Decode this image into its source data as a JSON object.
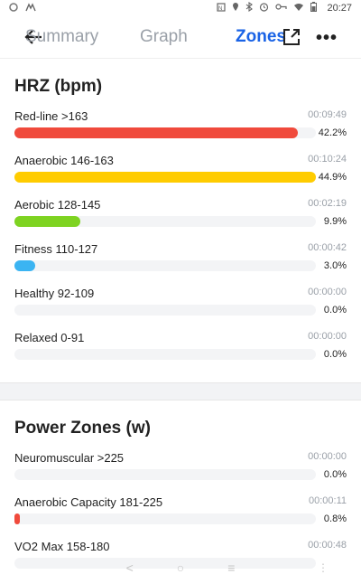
{
  "status": {
    "time": "20:27",
    "icons": [
      "notification-app-icon",
      "app-icon",
      "nfc-icon",
      "location-icon",
      "bluetooth-icon",
      "alarm-icon",
      "vpn-key-icon",
      "wifi-icon",
      "battery-icon"
    ]
  },
  "header": {
    "tabs": [
      {
        "label": "Summary",
        "active": false
      },
      {
        "label": "Graph",
        "active": false
      },
      {
        "label": "Zones",
        "active": true
      }
    ],
    "accent": "#1a63e6"
  },
  "hrz": {
    "title": "HRZ (bpm)",
    "zones": [
      {
        "name": "Red-line  >163",
        "time": "00:09:49",
        "pct_label": "42.2%",
        "fraction": 0.94,
        "color": "#f04a3c"
      },
      {
        "name": "Anaerobic  146-163",
        "time": "00:10:24",
        "pct_label": "44.9%",
        "fraction": 1.0,
        "color": "#ffcc00"
      },
      {
        "name": "Aerobic  128-145",
        "time": "00:02:19",
        "pct_label": "9.9%",
        "fraction": 0.22,
        "color": "#7ed321"
      },
      {
        "name": "Fitness  110-127",
        "time": "00:00:42",
        "pct_label": "3.0%",
        "fraction": 0.068,
        "color": "#3bb4f2"
      },
      {
        "name": "Healthy  92-109",
        "time": "00:00:00",
        "pct_label": "0.0%",
        "fraction": 0.0,
        "color": "#3bb4f2"
      },
      {
        "name": "Relaxed  0-91",
        "time": "00:00:00",
        "pct_label": "0.0%",
        "fraction": 0.0,
        "color": "#3bb4f2"
      }
    ]
  },
  "power": {
    "title": "Power Zones (w)",
    "zones": [
      {
        "name": "Neuromuscular  >225",
        "time": "00:00:00",
        "pct_label": "0.0%",
        "fraction": 0.0,
        "color": "#f04a3c"
      },
      {
        "name": "Anaerobic Capacity  181-225",
        "time": "00:00:11",
        "pct_label": "0.8%",
        "fraction": 0.018,
        "color": "#f04a3c"
      },
      {
        "name": "VO2 Max  158-180",
        "time": "00:00:48",
        "pct_label": "",
        "fraction": 0.0,
        "color": "#ffcc00"
      }
    ]
  }
}
